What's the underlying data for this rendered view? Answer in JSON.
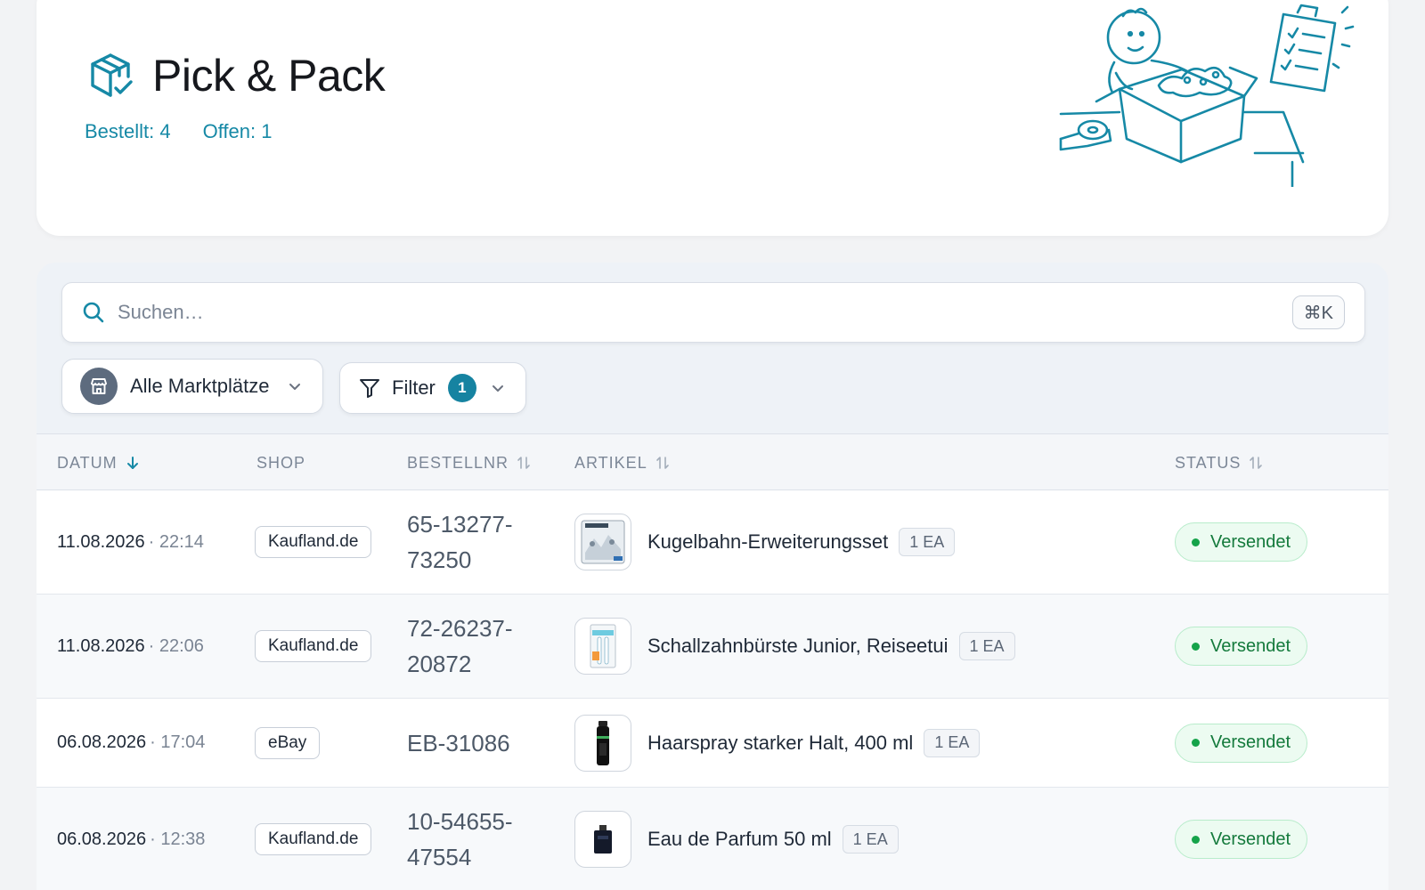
{
  "header": {
    "title": "Pick & Pack",
    "stats": {
      "ordered_label": "Bestellt: 4",
      "open_label": "Offen: 1"
    },
    "icon": "package-check-icon",
    "illustration": "packing-person-illustration"
  },
  "search": {
    "placeholder": "Suchen…",
    "value": "",
    "shortcut": "⌘K"
  },
  "filters": {
    "marketplace_label": "Alle Marktplätze",
    "filter_label": "Filter",
    "filter_count": "1"
  },
  "table": {
    "columns": {
      "date": "DATUM",
      "shop": "SHOP",
      "order_no": "BESTELLNR",
      "article": "ARTIKEL",
      "status": "STATUS"
    },
    "rows": [
      {
        "date": "11.08.2026",
        "time": "· 22:14",
        "shop": "Kaufland.de",
        "order_line1": "65-13277-",
        "order_line2": "73250",
        "article": "Kugelbahn-Erweiterungsset",
        "qty": "1 EA",
        "status": "Versendet",
        "thumb": "marble-run-box-thumbnail"
      },
      {
        "date": "11.08.2026",
        "time": "· 22:06",
        "shop": "Kaufland.de",
        "order_line1": "72-26237-",
        "order_line2": "20872",
        "article": "Schallzahnbürste Junior, Reiseetui",
        "qty": "1 EA",
        "status": "Versendet",
        "thumb": "toothbrush-box-thumbnail"
      },
      {
        "date": "06.08.2026",
        "time": "· 17:04",
        "shop": "eBay",
        "order_line1": "EB-31086",
        "order_line2": "",
        "article": "Haarspray starker Halt, 400 ml",
        "qty": "1 EA",
        "status": "Versendet",
        "thumb": "hairspray-can-thumbnail"
      },
      {
        "date": "06.08.2026",
        "time": "· 12:38",
        "shop": "Kaufland.de",
        "order_line1": "10-54655-",
        "order_line2": "47554",
        "article": "Eau de Parfum 50 ml",
        "qty": "1 EA",
        "status": "Versendet",
        "thumb": "perfume-bottle-thumbnail"
      }
    ]
  },
  "colors": {
    "accent": "#1689a6",
    "status_green": "#147a3c",
    "background": "#f2f3f5"
  }
}
